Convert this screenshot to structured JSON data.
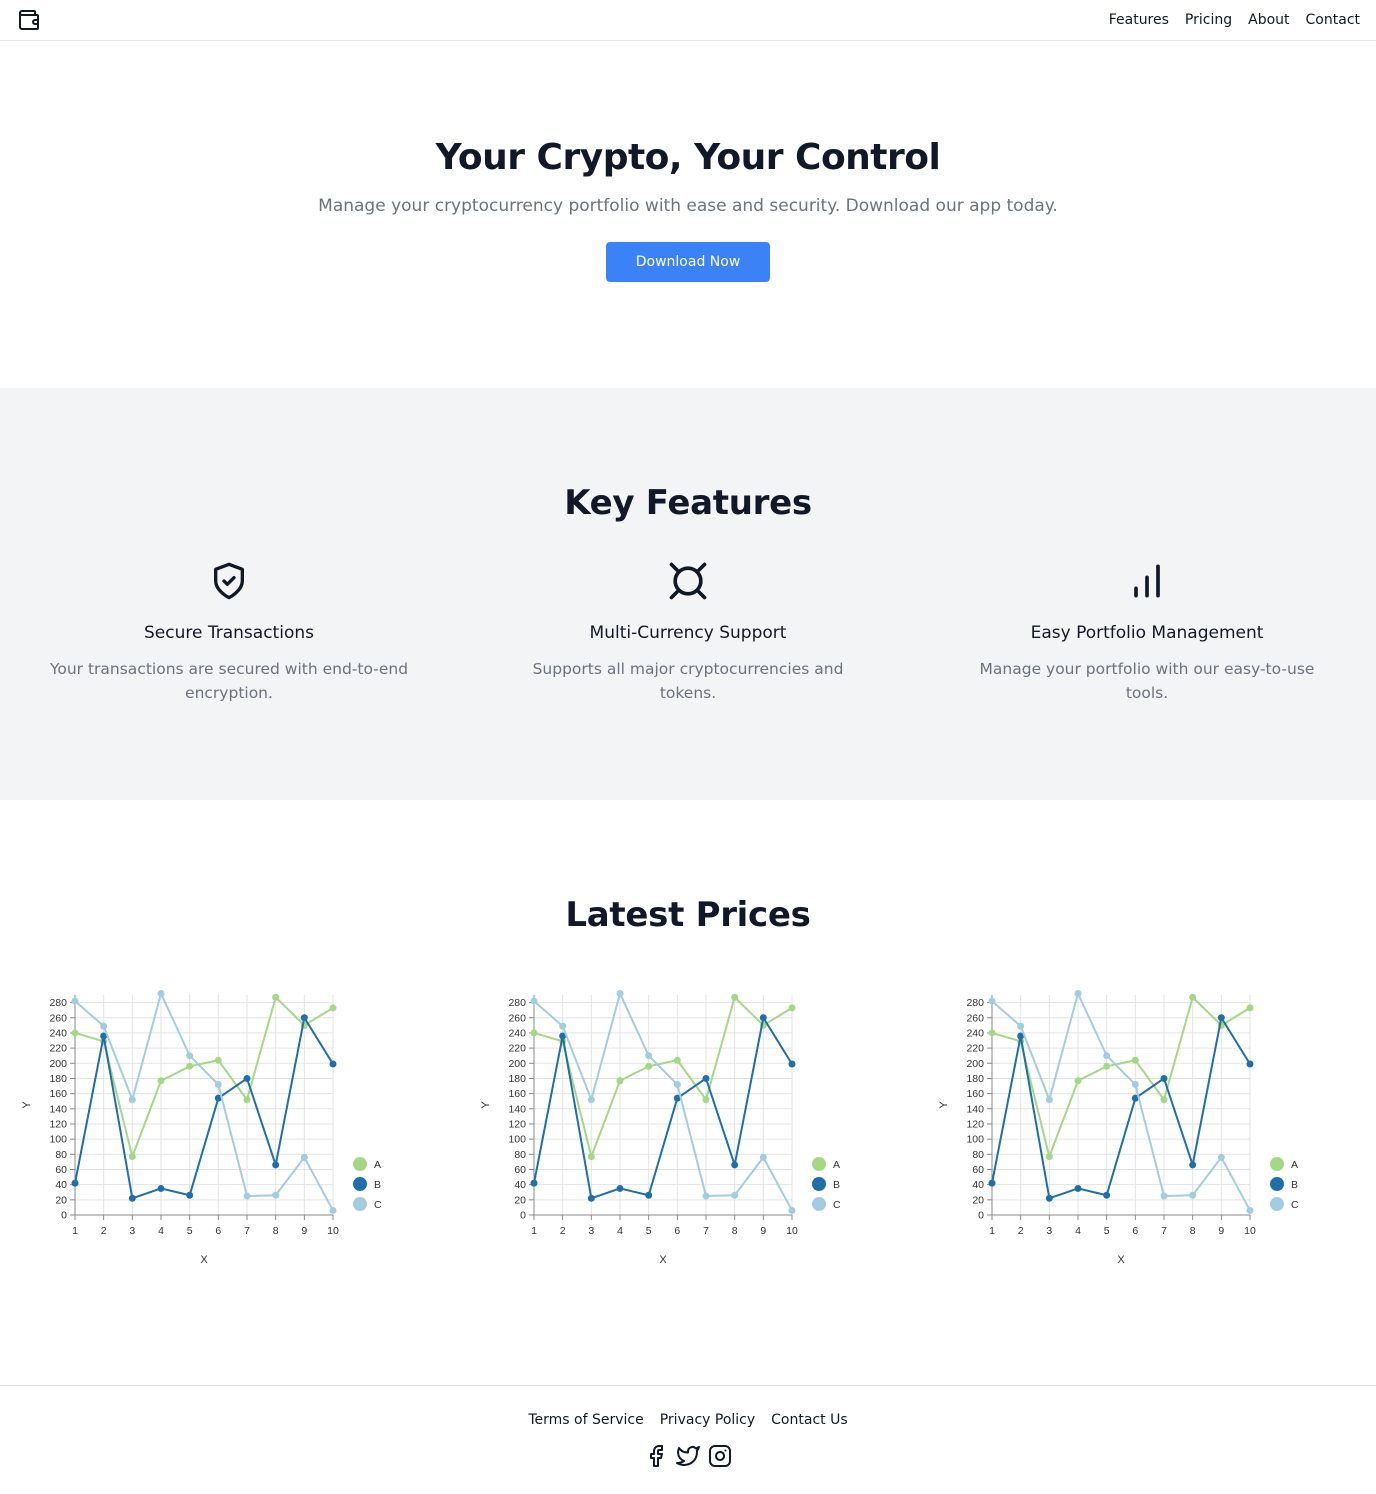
{
  "header": {
    "logo_icon": "wallet-icon",
    "nav": [
      "Features",
      "Pricing",
      "About",
      "Contact"
    ]
  },
  "hero": {
    "title": "Your Crypto, Your Control",
    "subtitle": "Manage your cryptocurrency portfolio with ease and security. Download our app today.",
    "cta_label": "Download Now",
    "cta_color": "#3b82f6"
  },
  "features": {
    "title": "Key Features",
    "items": [
      {
        "icon": "shield-check-icon",
        "title": "Secure Transactions",
        "desc": "Your transactions are secured with end-to-end encryption."
      },
      {
        "icon": "currency-icon",
        "title": "Multi-Currency Support",
        "desc": "Supports all major cryptocurrencies and tokens."
      },
      {
        "icon": "bar-chart-icon",
        "title": "Easy Portfolio Management",
        "desc": "Manage your portfolio with our easy-to-use tools."
      }
    ]
  },
  "prices": {
    "title": "Latest Prices"
  },
  "chart_data": [
    {
      "type": "line",
      "xlabel": "X",
      "ylabel": "Y",
      "x": [
        1,
        2,
        3,
        4,
        5,
        6,
        7,
        8,
        9,
        10
      ],
      "xlim": [
        1,
        10
      ],
      "ylim": [
        0,
        290
      ],
      "yticks": [
        0,
        20,
        40,
        60,
        80,
        100,
        120,
        140,
        160,
        180,
        200,
        220,
        240,
        260,
        280
      ],
      "grid": true,
      "legend_position": "right",
      "series": [
        {
          "name": "A",
          "color": "#a6d785",
          "values": [
            240,
            229,
            77,
            177,
            196,
            204,
            152,
            287,
            250,
            273
          ]
        },
        {
          "name": "B",
          "color": "#1f6fa8",
          "values": [
            42,
            236,
            22,
            35,
            26,
            154,
            180,
            66,
            260,
            199
          ]
        },
        {
          "name": "C",
          "color": "#a3cce0",
          "values": [
            282,
            249,
            152,
            292,
            210,
            172,
            25,
            26,
            76,
            6
          ]
        }
      ]
    },
    {
      "type": "line",
      "xlabel": "X",
      "ylabel": "Y",
      "x": [
        1,
        2,
        3,
        4,
        5,
        6,
        7,
        8,
        9,
        10
      ],
      "xlim": [
        1,
        10
      ],
      "ylim": [
        0,
        290
      ],
      "yticks": [
        0,
        20,
        40,
        60,
        80,
        100,
        120,
        140,
        160,
        180,
        200,
        220,
        240,
        260,
        280
      ],
      "grid": true,
      "legend_position": "right",
      "series": [
        {
          "name": "A",
          "color": "#a6d785",
          "values": [
            240,
            229,
            77,
            177,
            196,
            204,
            152,
            287,
            250,
            273
          ]
        },
        {
          "name": "B",
          "color": "#1f6fa8",
          "values": [
            42,
            236,
            22,
            35,
            26,
            154,
            180,
            66,
            260,
            199
          ]
        },
        {
          "name": "C",
          "color": "#a3cce0",
          "values": [
            282,
            249,
            152,
            292,
            210,
            172,
            25,
            26,
            76,
            6
          ]
        }
      ]
    },
    {
      "type": "line",
      "xlabel": "X",
      "ylabel": "Y",
      "x": [
        1,
        2,
        3,
        4,
        5,
        6,
        7,
        8,
        9,
        10
      ],
      "xlim": [
        1,
        10
      ],
      "ylim": [
        0,
        290
      ],
      "yticks": [
        0,
        20,
        40,
        60,
        80,
        100,
        120,
        140,
        160,
        180,
        200,
        220,
        240,
        260,
        280
      ],
      "grid": true,
      "legend_position": "right",
      "series": [
        {
          "name": "A",
          "color": "#a6d785",
          "values": [
            240,
            229,
            77,
            177,
            196,
            204,
            152,
            287,
            250,
            273
          ]
        },
        {
          "name": "B",
          "color": "#1f6fa8",
          "values": [
            42,
            236,
            22,
            35,
            26,
            154,
            180,
            66,
            260,
            199
          ]
        },
        {
          "name": "C",
          "color": "#a3cce0",
          "values": [
            282,
            249,
            152,
            292,
            210,
            172,
            25,
            26,
            76,
            6
          ]
        }
      ]
    }
  ],
  "footer": {
    "links": [
      "Terms of Service",
      "Privacy Policy",
      "Contact Us"
    ],
    "social_icons": [
      "facebook-icon",
      "twitter-icon",
      "instagram-icon"
    ]
  }
}
